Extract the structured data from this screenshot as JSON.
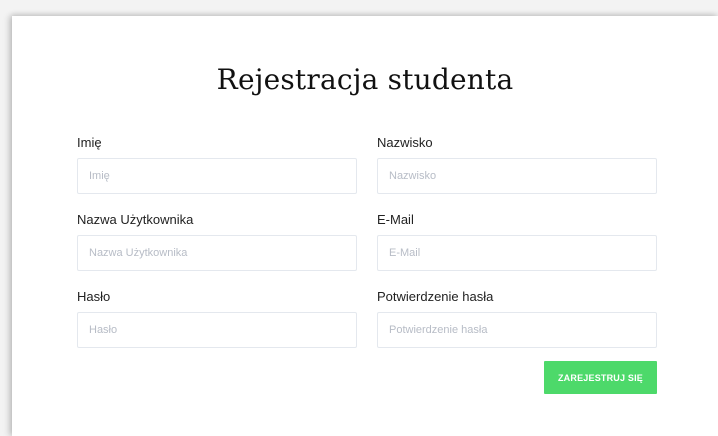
{
  "form": {
    "title": "Rejestracja studenta",
    "fields": {
      "first_name": {
        "label": "Imię",
        "placeholder": "Imię"
      },
      "last_name": {
        "label": "Nazwisko",
        "placeholder": "Nazwisko"
      },
      "username": {
        "label": "Nazwa Użytkownika",
        "placeholder": "Nazwa Użytkownika"
      },
      "email": {
        "label": "E-Mail",
        "placeholder": "E-Mail"
      },
      "password": {
        "label": "Hasło",
        "placeholder": "Hasło"
      },
      "password_confirm": {
        "label": "Potwierdzenie hasła",
        "placeholder": "Potwierdzenie hasła"
      }
    },
    "submit_label": "ZAREJESTRUJ SIĘ"
  },
  "colors": {
    "submit_button": "#4dd96a",
    "input_border": "#e4e8ee"
  }
}
